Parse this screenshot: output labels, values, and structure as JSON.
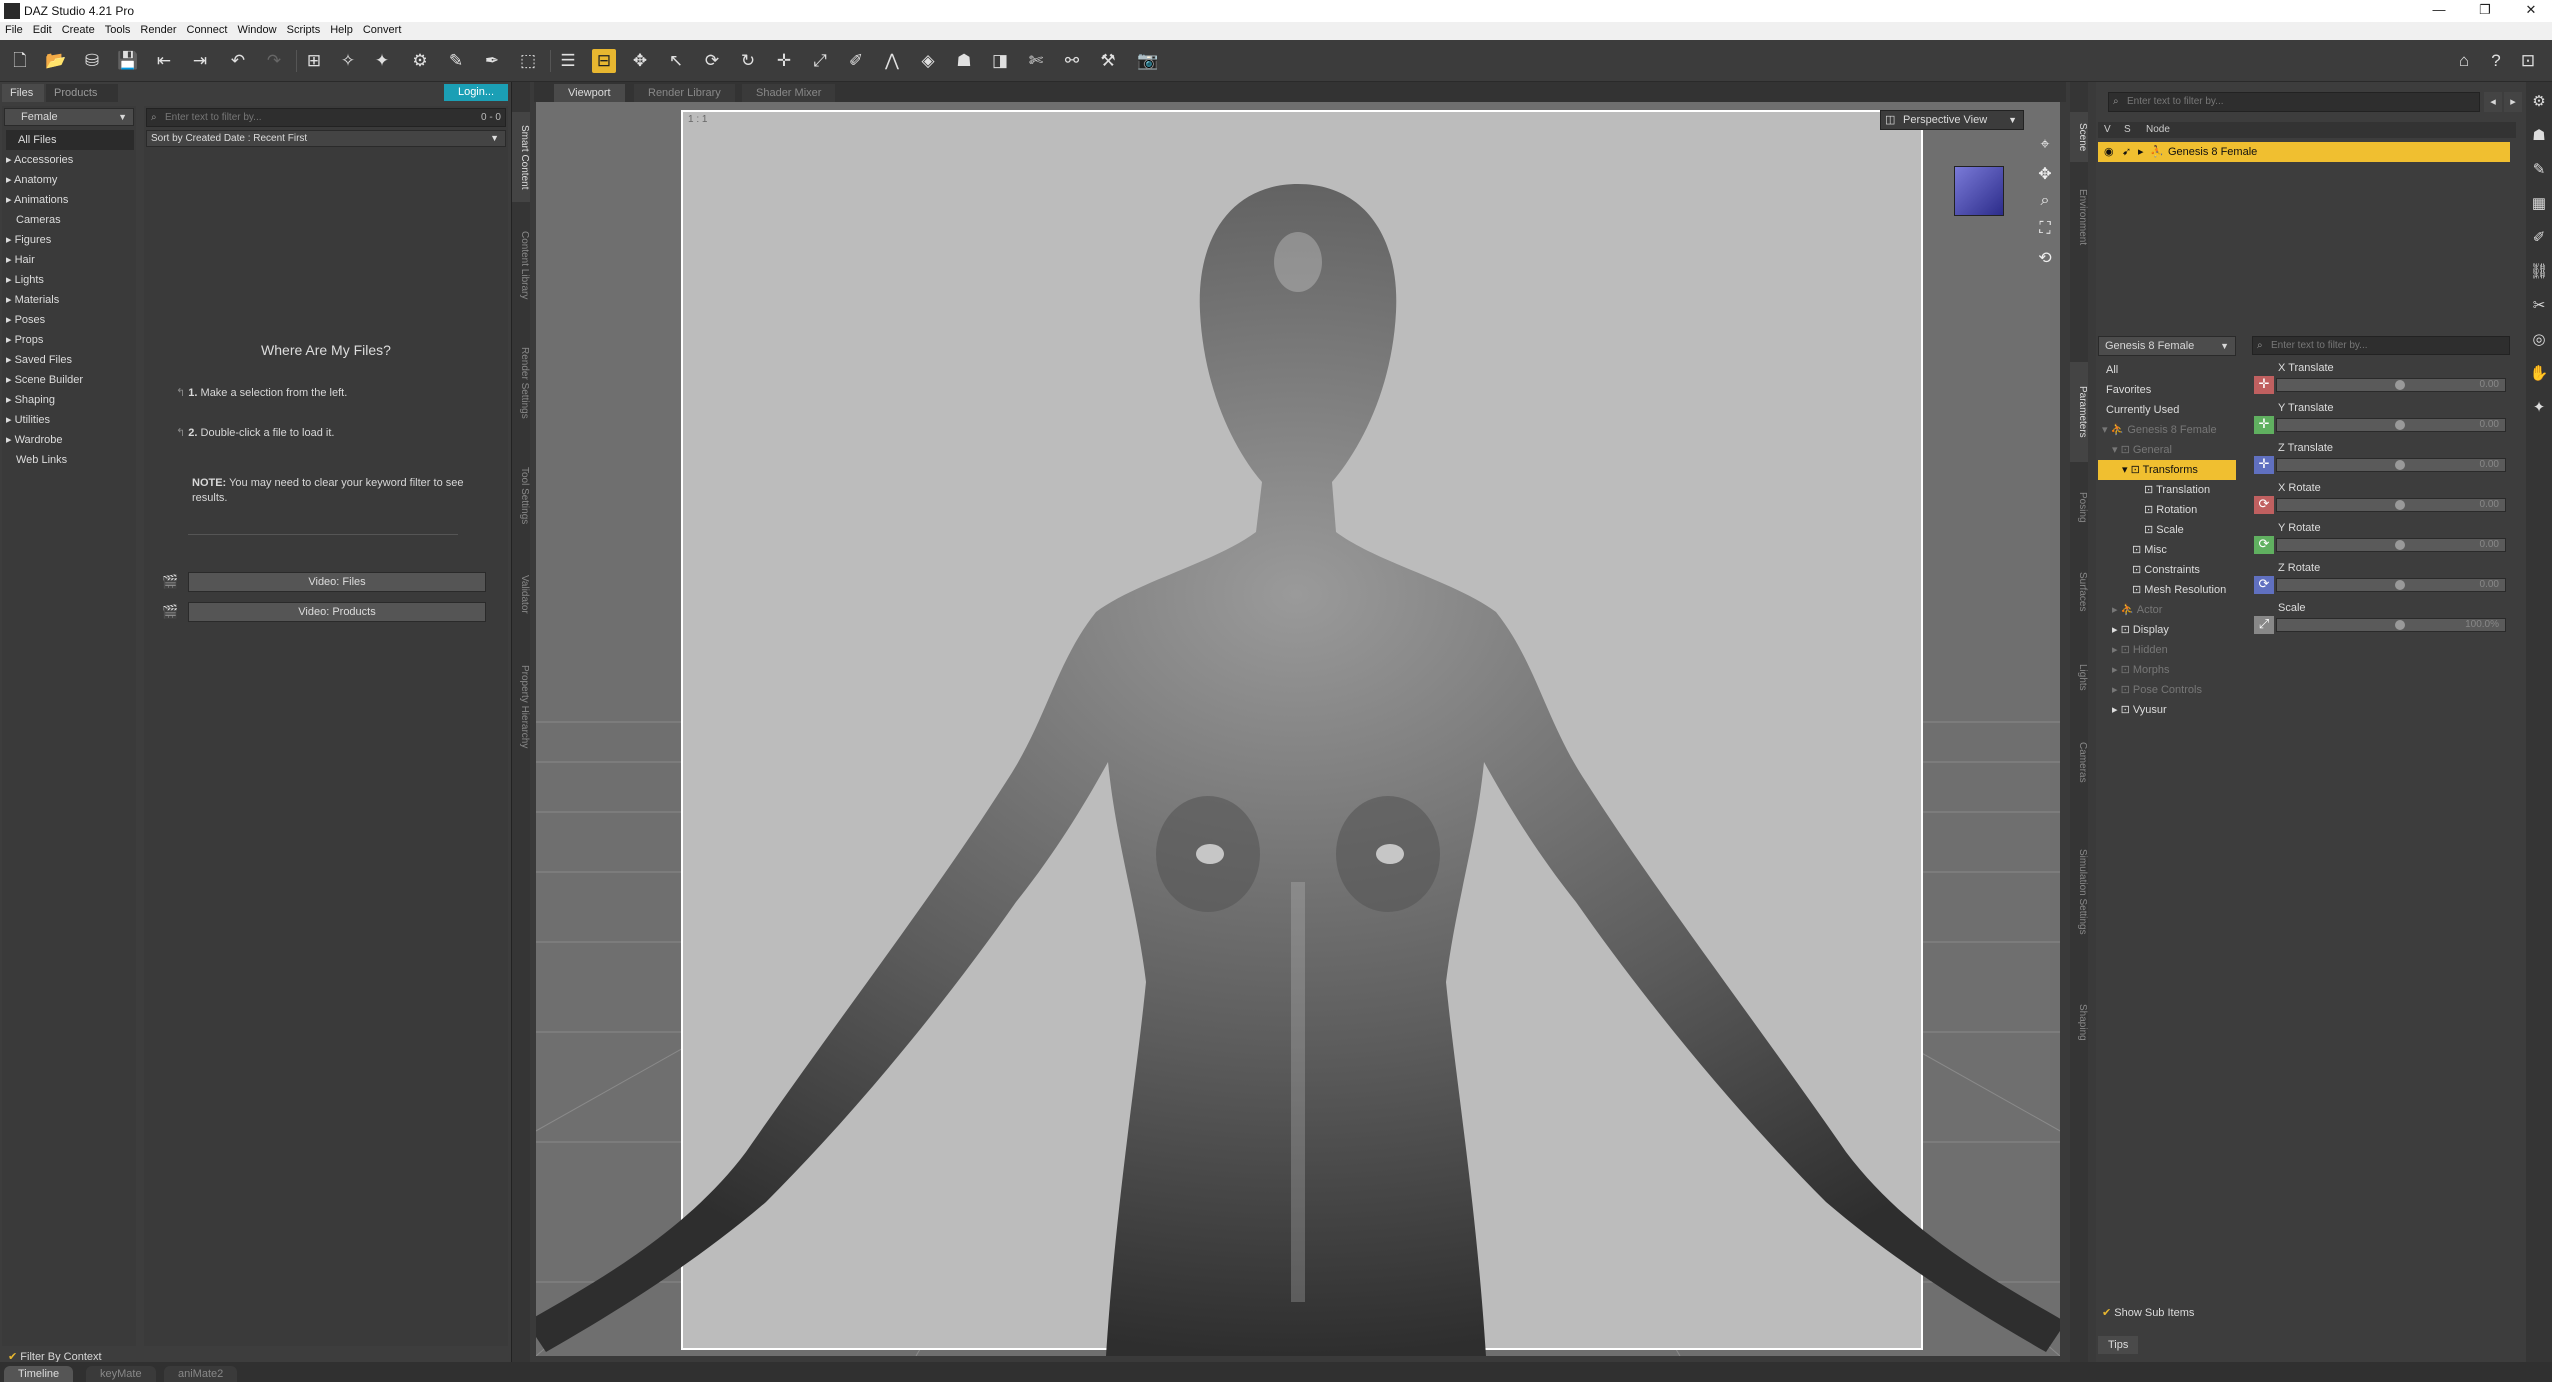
{
  "window": {
    "title": "DAZ Studio 4.21 Pro"
  },
  "menu": [
    "File",
    "Edit",
    "Create",
    "Tools",
    "Render",
    "Connect",
    "Window",
    "Scripts",
    "Help",
    "Convert"
  ],
  "left_panel": {
    "tabs": [
      "Files",
      "Products"
    ],
    "login_label": "Login...",
    "category_dropdown": "Female",
    "categories": [
      "All Files",
      "Accessories",
      "Anatomy",
      "Animations",
      "Cameras",
      "Figures",
      "Hair",
      "Lights",
      "Materials",
      "Poses",
      "Props",
      "Saved Files",
      "Scene Builder",
      "Shaping",
      "Utilities",
      "Wardrobe",
      "Web Links"
    ],
    "filter_placeholder": "Enter text to filter by...",
    "filter_count": "0 - 0",
    "sort_label": "Sort by Created Date : Recent First",
    "help_title": "Where Are My Files?",
    "step1_num": "1.",
    "step1": "Make a selection from the left.",
    "step2_num": "2.",
    "step2": "Double-click a file to load it.",
    "note_label": "NOTE:",
    "note": "You may need to clear your keyword filter to see results.",
    "video_files": "Video: Files",
    "video_products": "Video: Products",
    "filter_by_context": "Filter By Context"
  },
  "left_vtabs": [
    "Smart Content",
    "Content Library",
    "Render Settings",
    "Tool Settings",
    "Validator",
    "Property Hierarchy"
  ],
  "viewport": {
    "tabs": [
      "Viewport",
      "Render Library",
      "Shader Mixer"
    ],
    "view_label": "Perspective View",
    "corner_label": "1 : 1"
  },
  "right_vtabs": [
    "Scene",
    "Environment",
    "Parameters",
    "Posing",
    "Surfaces",
    "Lights",
    "Cameras",
    "Simulation Settings",
    "Shaping"
  ],
  "scene": {
    "filter_placeholder": "Enter text to filter by...",
    "col_v": "V",
    "col_s": "S",
    "col_node": "Node",
    "node": "Genesis 8 Female"
  },
  "parameters": {
    "node_dropdown": "Genesis 8 Female",
    "filter_placeholder": "Enter text to filter by...",
    "tree": [
      "All",
      "Favorites",
      "Currently Used",
      "Genesis 8 Female",
      "General",
      "Transforms",
      "Translation",
      "Rotation",
      "Scale",
      "Misc",
      "Constraints",
      "Mesh Resolution",
      "Actor",
      "Display",
      "Hidden",
      "Morphs",
      "Pose Controls",
      "Vyusur"
    ],
    "sliders": [
      {
        "label": "X Translate",
        "value": "0.00",
        "color": "#c06060"
      },
      {
        "label": "Y Translate",
        "value": "0.00",
        "color": "#60b060"
      },
      {
        "label": "Z Translate",
        "value": "0.00",
        "color": "#6070c0"
      },
      {
        "label": "X Rotate",
        "value": "0.00",
        "color": "#c06060"
      },
      {
        "label": "Y Rotate",
        "value": "0.00",
        "color": "#60b060"
      },
      {
        "label": "Z Rotate",
        "value": "0.00",
        "color": "#6070c0"
      },
      {
        "label": "Scale",
        "value": "100.0%",
        "color": "#888888"
      }
    ],
    "show_sub_items": "Show Sub Items",
    "tips": "Tips"
  },
  "bottom_tabs": [
    "Timeline",
    "keyMate",
    "aniMate2"
  ]
}
